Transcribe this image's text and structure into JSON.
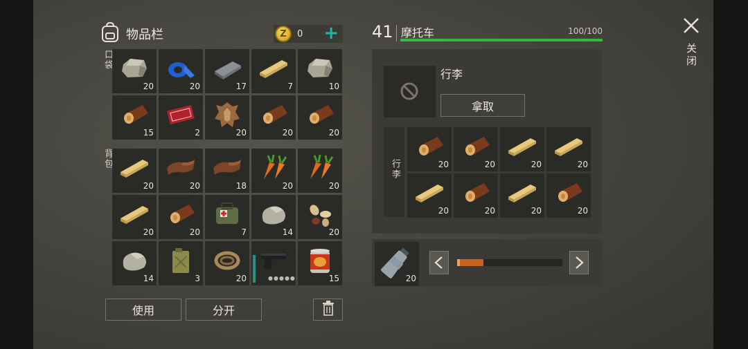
{
  "inventory": {
    "title": "物品栏",
    "coins": "0",
    "pocket_label": "口袋",
    "backpack_label": "背包",
    "pocket": [
      {
        "icon": "stone-icon",
        "count": "20"
      },
      {
        "icon": "duct-tape-icon",
        "count": "20"
      },
      {
        "icon": "iron-bar-icon",
        "count": "17"
      },
      {
        "icon": "plank-icon",
        "count": "7"
      },
      {
        "icon": "stone-icon",
        "count": "10"
      },
      {
        "icon": "log-icon",
        "count": "15"
      },
      {
        "icon": "coupon-icon",
        "count": "2"
      },
      {
        "icon": "hide-icon",
        "count": "20"
      },
      {
        "icon": "log-icon",
        "count": "20"
      },
      {
        "icon": "log-icon",
        "count": "20"
      }
    ],
    "backpack": [
      {
        "icon": "plank-icon",
        "count": "20"
      },
      {
        "icon": "leather-icon",
        "count": "20"
      },
      {
        "icon": "leather-icon",
        "count": "18"
      },
      {
        "icon": "carrot-icon",
        "count": "20"
      },
      {
        "icon": "carrot-icon",
        "count": "20"
      },
      {
        "icon": "plank-icon",
        "count": "20"
      },
      {
        "icon": "log-icon",
        "count": "20"
      },
      {
        "icon": "medkit-bag-icon",
        "count": "7"
      },
      {
        "icon": "rock-icon",
        "count": "14"
      },
      {
        "icon": "seeds-icon",
        "count": "20"
      },
      {
        "icon": "rock-icon",
        "count": "14"
      },
      {
        "icon": "jerrycan-icon",
        "count": "3"
      },
      {
        "icon": "rope-icon",
        "count": "20"
      },
      {
        "icon": "pistol-icon",
        "count": ""
      },
      {
        "icon": "canned-food-icon",
        "count": "15"
      }
    ],
    "use_label": "使用",
    "split_label": "分开"
  },
  "vehicle": {
    "level": "41",
    "name": "摩托车",
    "durability": "100/100",
    "durability_fraction": 1.0,
    "luggage_title": "行李",
    "take_label": "拿取",
    "luggage_side_label": "行李",
    "luggage": [
      {
        "icon": "log-icon",
        "count": "20"
      },
      {
        "icon": "log-icon",
        "count": "20"
      },
      {
        "icon": "plank-icon",
        "count": "20"
      },
      {
        "icon": "plank-icon",
        "count": "20"
      },
      {
        "icon": "plank-icon",
        "count": "20"
      },
      {
        "icon": "log-icon",
        "count": "20"
      },
      {
        "icon": "plank-icon",
        "count": "20"
      },
      {
        "icon": "log-icon",
        "count": "20"
      }
    ],
    "fuel_item": {
      "icon": "water-bottle-icon",
      "count": "20"
    },
    "fuel_fraction": 0.25
  },
  "close_label": "关闭",
  "colors": {
    "accent": "#19b9a3",
    "durability": "#2fbc3a",
    "fuel": "#c8621e"
  }
}
